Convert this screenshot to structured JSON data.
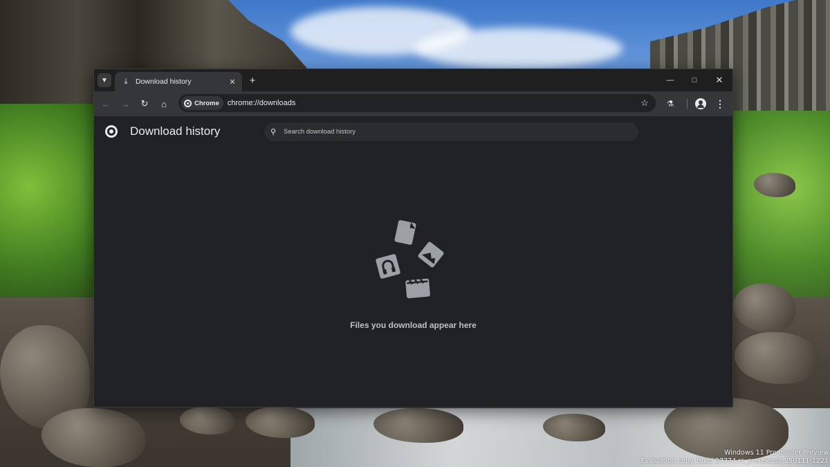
{
  "browser": {
    "tab": {
      "title": "Download history"
    },
    "omnibox": {
      "chip_label": "Chrome",
      "url": "chrome://downloads"
    }
  },
  "page": {
    "title": "Download history",
    "search": {
      "placeholder": "Search download history"
    },
    "empty_message": "Files you download appear here"
  },
  "desktop": {
    "watermark_line1": "Windows 11 Pro Insider Preview",
    "watermark_line2": "Evaluation copy. Build 27774.rs_prerelease.250111-1221"
  },
  "icons": [
    "chevron-down-icon",
    "download-icon",
    "close-icon",
    "plus-icon",
    "minimize-icon",
    "maximize-icon",
    "back-arrow-icon",
    "forward-arrow-icon",
    "reload-icon",
    "home-icon",
    "star-icon",
    "labs-flask-icon",
    "profile-icon",
    "more-vert-icon",
    "chrome-logo-icon",
    "search-icon"
  ],
  "colors": {
    "window_bg": "#202124",
    "toolbar_bg": "#35363a",
    "text": "#e8eaed",
    "muted_text": "#bdc1c6"
  }
}
